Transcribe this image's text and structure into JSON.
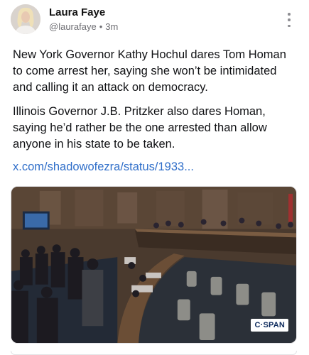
{
  "post": {
    "author": {
      "name": "Laura Faye",
      "handle": "@laurafaye",
      "separator": "•",
      "time": "3m"
    },
    "paragraphs": [
      "New York Governor Kathy Hochul dares Tom Homan to come arrest her, saying she won’t be intimidated and calling it an attack on democracy.",
      "Illinois Governor J.B. Pritzker also dares Homan, saying he’d rather be the one arrested than allow anyone in his state to be taken."
    ],
    "link_text": "x.com/shadowofezra/status/1933...",
    "media": {
      "watermark": "C·SPAN"
    },
    "menu_icon": "more-vertical-icon"
  }
}
